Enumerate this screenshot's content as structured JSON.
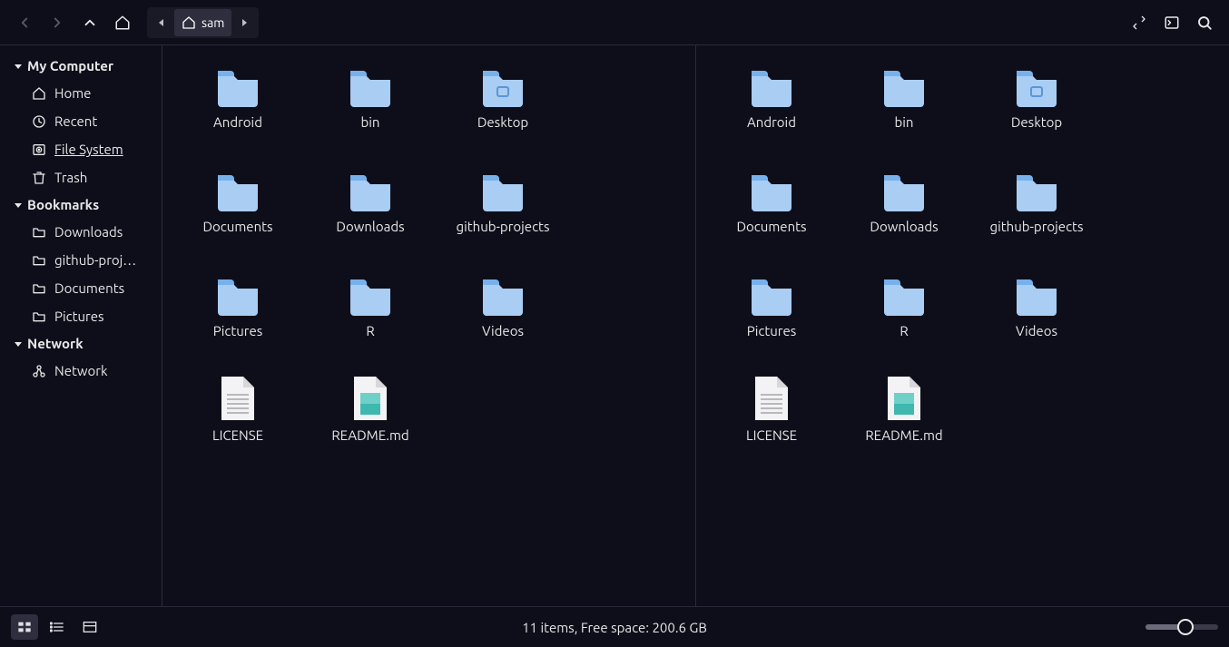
{
  "toolbar": {
    "path_current": "sam"
  },
  "sidebar": {
    "sections": [
      {
        "header": "My Computer",
        "items": [
          {
            "icon": "home",
            "label": "Home"
          },
          {
            "icon": "recent",
            "label": "Recent"
          },
          {
            "icon": "disk",
            "label": "File System",
            "active": true
          },
          {
            "icon": "trash",
            "label": "Trash"
          }
        ]
      },
      {
        "header": "Bookmarks",
        "items": [
          {
            "icon": "folder",
            "label": "Downloads"
          },
          {
            "icon": "folder",
            "label": "github-proj…"
          },
          {
            "icon": "folder",
            "label": "Documents"
          },
          {
            "icon": "folder",
            "label": "Pictures"
          }
        ]
      },
      {
        "header": "Network",
        "items": [
          {
            "icon": "network",
            "label": "Network"
          }
        ]
      }
    ]
  },
  "contents": [
    {
      "type": "folder",
      "label": "Android"
    },
    {
      "type": "folder",
      "label": "bin"
    },
    {
      "type": "folder-marked",
      "label": "Desktop"
    },
    {
      "type": "folder",
      "label": "Documents"
    },
    {
      "type": "folder",
      "label": "Downloads"
    },
    {
      "type": "folder",
      "label": "github-projects"
    },
    {
      "type": "folder",
      "label": "Pictures"
    },
    {
      "type": "folder",
      "label": "R"
    },
    {
      "type": "folder",
      "label": "Videos"
    },
    {
      "type": "file-text",
      "label": "LICENSE"
    },
    {
      "type": "file-image",
      "label": "README.md"
    }
  ],
  "footer": {
    "status": "11 items, Free space: 200.6 GB"
  }
}
